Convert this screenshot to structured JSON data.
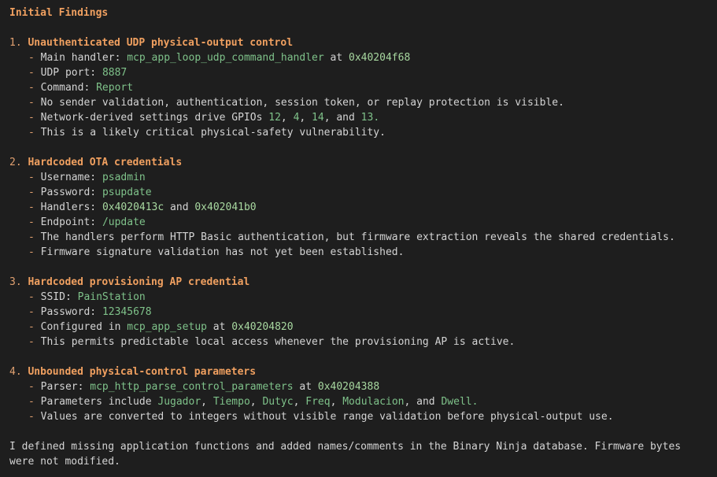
{
  "heading": "Initial Findings",
  "f1": {
    "num": "1.",
    "title": "Unauthenticated UDP physical-output control",
    "b1_label": "Main handler: ",
    "b1_fn": "mcp_app_loop_udp_command_handler",
    "b1_at": " at ",
    "b1_addr": "0x40204f68",
    "b2_label": "UDP port: ",
    "b2_val": "8887",
    "b3_label": "Command: ",
    "b3_val": "Report",
    "b4": "No sender validation, authentication, session token, or replay protection is visible.",
    "b5_label": "Network-derived settings drive GPIOs ",
    "b5_g1": "12",
    "b5_s1": ", ",
    "b5_g2": "4",
    "b5_s2": ", ",
    "b5_g3": "14",
    "b5_s3": ", and ",
    "b5_g4": "13.",
    "b6": "This is a likely critical physical-safety vulnerability."
  },
  "f2": {
    "num": "2.",
    "title": "Hardcoded OTA credentials",
    "b1_label": "Username: ",
    "b1_val": "psadmin",
    "b2_label": "Password: ",
    "b2_val": "psupdate",
    "b3_label": "Handlers: ",
    "b3_v1": "0x4020413c",
    "b3_and": " and ",
    "b3_v2": "0x402041b0",
    "b4_label": "Endpoint: ",
    "b4_val": "/update",
    "b5": "The handlers perform HTTP Basic authentication, but firmware extraction reveals the shared credentials.",
    "b6": "Firmware signature validation has not yet been established."
  },
  "f3": {
    "num": "3.",
    "title": "Hardcoded provisioning AP credential",
    "b1_label": "SSID: ",
    "b1_val": "PainStation",
    "b2_label": "Password: ",
    "b2_val": "12345678",
    "b3_label": "Configured in ",
    "b3_fn": "mcp_app_setup",
    "b3_at": " at ",
    "b3_addr": "0x40204820",
    "b4": "This permits predictable local access whenever the provisioning AP is active."
  },
  "f4": {
    "num": "4.",
    "title": "Unbounded physical-control parameters",
    "b1_label": "Parser: ",
    "b1_fn": "mcp_http_parse_control_parameters",
    "b1_at": " at ",
    "b1_addr": "0x40204388",
    "b2_label": "Parameters include ",
    "b2_p1": "Jugador",
    "b2_s1": ", ",
    "b2_p2": "Tiempo",
    "b2_s2": ", ",
    "b2_p3": "Dutyc",
    "b2_s3": ", ",
    "b2_p4": "Freq",
    "b2_s4": ", ",
    "b2_p5": "Modulacion",
    "b2_s5": ", and ",
    "b2_p6": "Dwell.",
    "b3": "Values are converted to integers without visible range validation before physical-output use."
  },
  "footer": "I defined missing application functions and added names/comments in the Binary Ninja database. Firmware bytes were not modified.",
  "dash": "- ",
  "colors": {
    "background": "#1e1e1e",
    "heading": "#f0a060",
    "code": "#7fc28a",
    "text": "#d4d4d4"
  }
}
